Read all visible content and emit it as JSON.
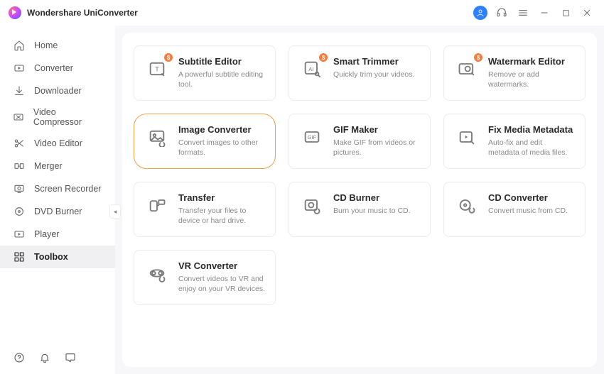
{
  "app": {
    "title": "Wondershare UniConverter"
  },
  "sidebar": {
    "items": [
      {
        "label": "Home"
      },
      {
        "label": "Converter"
      },
      {
        "label": "Downloader"
      },
      {
        "label": "Video Compressor"
      },
      {
        "label": "Video Editor"
      },
      {
        "label": "Merger"
      },
      {
        "label": "Screen Recorder"
      },
      {
        "label": "DVD Burner"
      },
      {
        "label": "Player"
      },
      {
        "label": "Toolbox"
      }
    ]
  },
  "tools": [
    {
      "title": "Subtitle Editor",
      "desc": "A powerful subtitle editing tool.",
      "badge": "$"
    },
    {
      "title": "Smart Trimmer",
      "desc": "Quickly trim your videos.",
      "badge": "$"
    },
    {
      "title": "Watermark Editor",
      "desc": "Remove or add watermarks.",
      "badge": "$"
    },
    {
      "title": "Image Converter",
      "desc": "Convert images to other formats.",
      "selected": true
    },
    {
      "title": "GIF Maker",
      "desc": "Make GIF from videos or pictures."
    },
    {
      "title": "Fix Media Metadata",
      "desc": "Auto-fix and edit metadata of media files."
    },
    {
      "title": "Transfer",
      "desc": "Transfer your files to device or hard drive."
    },
    {
      "title": "CD Burner",
      "desc": "Burn your music to CD."
    },
    {
      "title": "CD Converter",
      "desc": "Convert music from CD."
    },
    {
      "title": "VR Converter",
      "desc": "Convert videos to VR and enjoy on your VR devices."
    }
  ]
}
